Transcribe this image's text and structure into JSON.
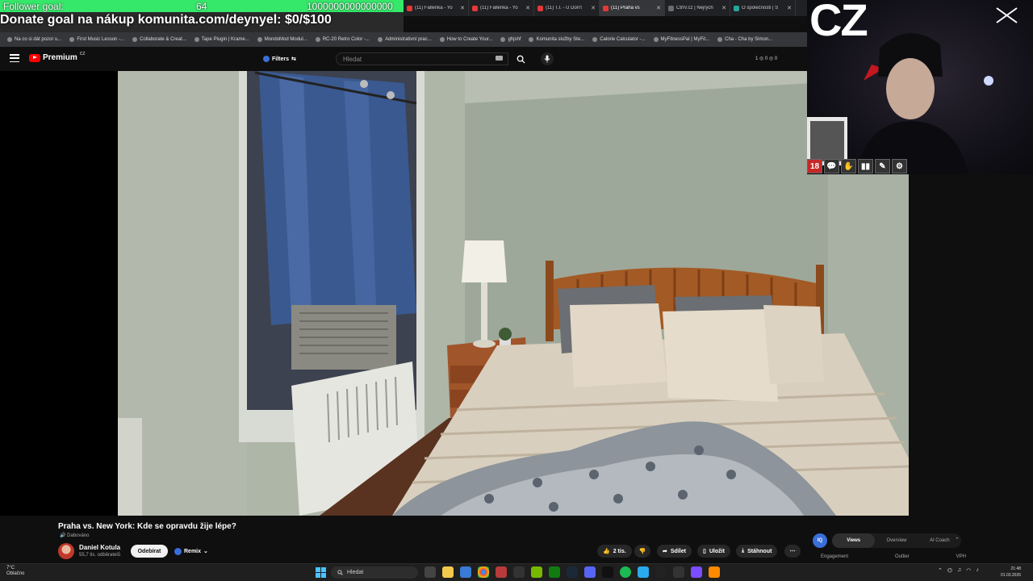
{
  "overlay": {
    "follower_goal_label": "Follower goal:",
    "follower_goal_current": "64",
    "follower_goal_target": "1000000000000000",
    "follower_goal_progress": 0.0,
    "donate_text": "Donate goal na nákup komunita.com/deynyel: $0/$100",
    "webcam_label": "CZ",
    "badges": [
      "18",
      "💬",
      "✋",
      "▮▮",
      "✎",
      "⚙"
    ]
  },
  "browser": {
    "tabs": [
      {
        "label": "(11) Fallenka - Yo",
        "icon": "youtube-icon"
      },
      {
        "label": "(11) Fallenka - Yo",
        "icon": "youtube-icon"
      },
      {
        "label": "(11) T.I. - U Don't",
        "icon": "youtube-icon"
      },
      {
        "label": "(11) Praha vs",
        "icon": "youtube-icon",
        "active": true
      },
      {
        "label": "CtrlV.cz | Nejrych",
        "icon": "ctrlv-icon"
      },
      {
        "label": "O společnosti | S",
        "icon": "globe-icon"
      }
    ],
    "bookmarks": [
      "Na co si dát pozor u...",
      "First Music Lesson -...",
      "Collaborate & Creat...",
      "Tape Plugin | Krame...",
      "MondoMod Modul...",
      "RC-20 Retro Color -...",
      "Administrativní prac...",
      "How to Create Your...",
      "ghjshf",
      "Komunita služby Ste...",
      "Calorie Calculator -...",
      "MyFitnessPal | MyFit...",
      "Cha - Cha by Simon..."
    ]
  },
  "youtube": {
    "logo_text": "Premium",
    "logo_region": "CZ",
    "filters_label": "Filters",
    "search_placeholder": "Hledat",
    "header_stats": "1 ◎ 0 ◎ 0",
    "video": {
      "title": "Praha vs. New York: Kde se opravdu žije lépe?",
      "dub_label": "Dabováno",
      "channel_name": "Daniel Kotula",
      "subscribers": "55,7 tis. odběratelů",
      "subscribe_label": "Odebírat",
      "remix_label": "Remix",
      "likes": "2 tis.",
      "share_label": "Sdílet",
      "save_label": "Uložit",
      "download_label": "Stáhnout"
    },
    "analytics": {
      "icon_label": "IQ",
      "tabs": [
        "Views",
        "Overview",
        "AI Coach"
      ],
      "active_tab": "Views",
      "metrics": [
        "Engagement",
        "Outlier",
        "VPH"
      ]
    }
  },
  "taskbar": {
    "weather_temp": "7°C",
    "weather_text": "Oblačno",
    "search_label": "Hledat",
    "time": "21:48",
    "date": "01.03.2026"
  }
}
